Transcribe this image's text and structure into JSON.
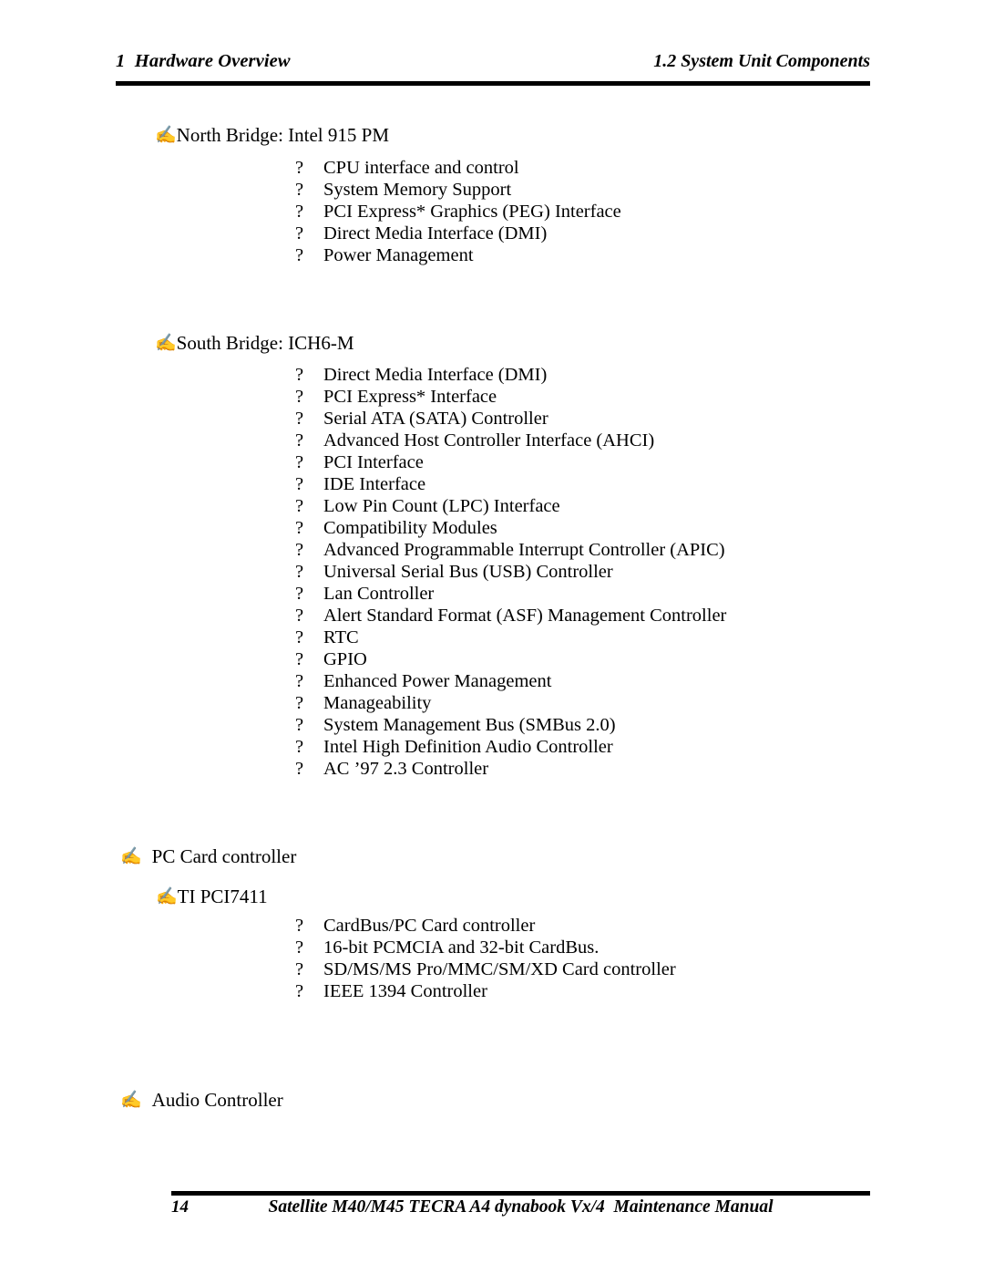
{
  "header": {
    "left": "1  Hardware Overview",
    "right": "1.2 System Unit Components"
  },
  "bullets": {
    "level1_glyph": "✍",
    "level2_glyph": "?"
  },
  "sections": [
    {
      "name": "north-bridge",
      "heading": "North Bridge: Intel 915 PM",
      "items": [
        "CPU interface and control",
        "System Memory Support",
        "PCI Express* Graphics (PEG) Interface",
        "Direct Media Interface (DMI)",
        "Power Management"
      ]
    },
    {
      "name": "south-bridge",
      "heading": "South Bridge: ICH6-M",
      "items": [
        "Direct Media Interface (DMI)",
        "PCI Express* Interface",
        "Serial ATA (SATA) Controller",
        "Advanced Host Controller Interface (AHCI)",
        "PCI Interface",
        "IDE Interface",
        "Low Pin Count (LPC) Interface",
        "Compatibility Modules",
        "Advanced Programmable Interrupt Controller (APIC)",
        "Universal Serial Bus (USB) Controller",
        "Lan Controller",
        "Alert Standard Format (ASF) Management Controller",
        "RTC",
        "GPIO",
        "Enhanced Power Management",
        "Manageability",
        "System Management Bus (SMBus 2.0)",
        "Intel High Definition Audio Controller",
        "AC ’97 2.3 Controller"
      ]
    },
    {
      "name": "pc-card-controller",
      "heading": "PC Card controller",
      "subheading": "TI PCI7411",
      "items": [
        "CardBus/PC Card controller",
        "16-bit PCMCIA and 32-bit CardBus.",
        "SD/MS/MS Pro/MMC/SM/XD Card controller",
        "IEEE 1394 Controller"
      ]
    },
    {
      "name": "audio-controller",
      "heading": "Audio Controller",
      "items": []
    }
  ],
  "footer": {
    "page_number": "14",
    "title": "Satellite M40/M45 TECRA A4 dynabook Vx/4  Maintenance Manual"
  }
}
